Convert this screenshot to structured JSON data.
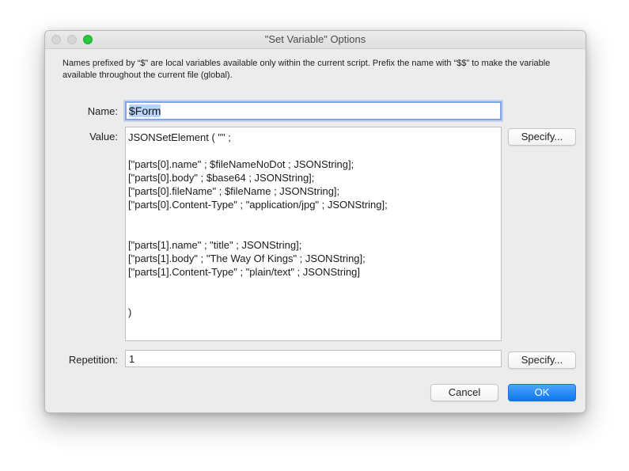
{
  "window": {
    "title": "\"Set Variable\" Options",
    "description": "Names prefixed by “$” are local variables available only within the current script. Prefix the name with “$$” to make the variable available throughout the current file (global)."
  },
  "name": {
    "label": "Name:",
    "value": "$Form"
  },
  "value": {
    "label": "Value:",
    "text": "JSONSetElement ( \"\" ;\n\n[\"parts[0].name\" ; $fileNameNoDot ; JSONString];\n[\"parts[0].body\" ; $base64 ; JSONString];\n[\"parts[0].fileName\" ; $fileName ; JSONString];\n[\"parts[0].Content-Type\" ; \"application/jpg\" ; JSONString];\n\n\n[\"parts[1].name\" ; \"title\" ; JSONString];\n[\"parts[1].body\" ; \"The Way Of Kings\" ; JSONString];\n[\"parts[1].Content-Type\" ; \"plain/text\" ; JSONString]\n\n\n)",
    "specify_label": "Specify..."
  },
  "repetition": {
    "label": "Repetition:",
    "value": "1",
    "specify_label": "Specify..."
  },
  "actions": {
    "cancel_label": "Cancel",
    "ok_label": "OK"
  },
  "colors": {
    "accent": "#0c76ef",
    "focus_ring": "#7fa8e8",
    "traffic_green": "#27c93f",
    "traffic_inactive": "#d6d6d6"
  }
}
